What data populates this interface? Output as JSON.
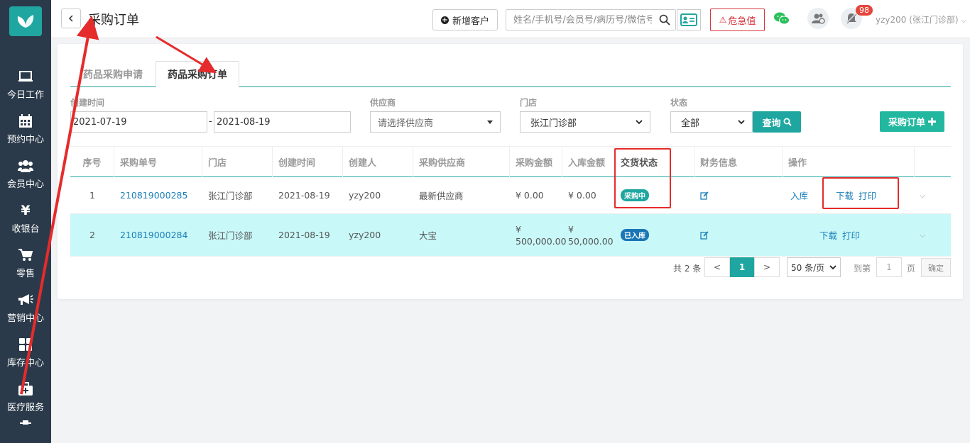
{
  "header": {
    "title": "采购订单",
    "add_customer_label": "新增客户",
    "search_placeholder": "姓名/手机号/会员号/病历号/微信号",
    "danger_label": "危急值",
    "notification_count": "98",
    "user_label": "yzy200 (张江门诊部)"
  },
  "sidebar": {
    "items": [
      {
        "label": "今日工作",
        "icon": "monitor-icon"
      },
      {
        "label": "预约中心",
        "icon": "calendar-icon"
      },
      {
        "label": "会员中心",
        "icon": "users-icon"
      },
      {
        "label": "收银台",
        "icon": "yen-icon"
      },
      {
        "label": "零售",
        "icon": "cart-icon"
      },
      {
        "label": "营销中心",
        "icon": "megaphone-icon"
      },
      {
        "label": "库存中心",
        "icon": "grid-icon"
      },
      {
        "label": "医疗服务",
        "icon": "medkit-icon"
      }
    ]
  },
  "tabs": [
    {
      "label": "药品采购申请"
    },
    {
      "label": "药品采购订单"
    }
  ],
  "filters": {
    "created_time_label": "创建时间",
    "date_from": "2021-07-19",
    "date_sep": "-",
    "date_to": "2021-08-19",
    "supplier_label": "供应商",
    "supplier_placeholder": "请选择供应商",
    "store_label": "门店",
    "store_value": "张江门诊部",
    "status_label": "状态",
    "status_value": "全部",
    "query_label": "查询",
    "order_button_label": "采购订单"
  },
  "table": {
    "columns": [
      "序号",
      "采购单号",
      "门店",
      "创建时间",
      "创建人",
      "采购供应商",
      "采购金额",
      "入库金额",
      "交货状态",
      "财务信息",
      "操作"
    ],
    "rows": [
      {
        "index": "1",
        "order_no": "210819000285",
        "store": "张江门诊部",
        "created": "2021-08-19",
        "creator": "yzy200",
        "supplier": "最新供应商",
        "amount": "¥ 0.00",
        "stock_amount": "¥ 0.00",
        "status": "采购中",
        "op_stock": "入库",
        "op_download": "下载",
        "op_print": "打印"
      },
      {
        "index": "2",
        "order_no": "210819000284",
        "store": "张江门诊部",
        "created": "2021-08-19",
        "creator": "yzy200",
        "supplier": "大宝",
        "amount_symbol": "¥",
        "amount_value": "500,000.00",
        "stock_symbol": "¥",
        "stock_value": "50,000.00",
        "status": "已入库",
        "op_download": "下载",
        "op_print": "打印"
      }
    ]
  },
  "pagination": {
    "total": "共 2 条",
    "prev": "<",
    "page": "1",
    "next": ">",
    "page_size": "50 条/页",
    "goto": "到第",
    "goto_value": "1",
    "page_unit": "页",
    "confirm": "确定"
  },
  "colors": {
    "sidebar_bg": "#2b3a4a",
    "accent": "#1fa6a0",
    "link": "#1a7fb8",
    "danger": "#d9363e",
    "highlight_row": "#c9f8f8",
    "annotation": "#e52b2b"
  }
}
